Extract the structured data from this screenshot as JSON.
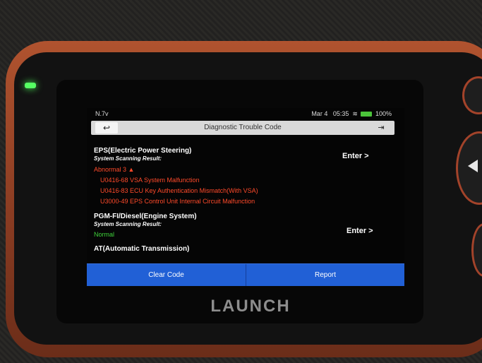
{
  "device": {
    "brand": "LAUNCH"
  },
  "status_bar": {
    "left": "N.7v",
    "date": "Mar 4",
    "time": "05:35",
    "battery": "100%"
  },
  "titlebar": {
    "back_icon": "↩",
    "title": "Diagnostic Trouble Code",
    "exit_icon": "exit-icon"
  },
  "systems": [
    {
      "name": "EPS(Electric Power Steering)",
      "scan_label": "System Scanning Result:",
      "status": "Abnormal 3",
      "enter": "Enter >",
      "codes": [
        "U0416-68 VSA System Malfunction",
        "U0416-83 ECU Key Authentication Mismatch(With VSA)",
        "U3000-49 EPS Control Unit Internal Circuit Malfunction"
      ]
    },
    {
      "name": "PGM-FI/Diesel(Engine System)",
      "scan_label": "System Scanning Result:",
      "status": "Normal",
      "enter": "Enter >"
    },
    {
      "name": "AT(Automatic Transmission)"
    }
  ],
  "bottom_bar": {
    "clear": "Clear Code",
    "report": "Report"
  },
  "colors": {
    "abnormal": "#ff4a2a",
    "normal": "#3fd23a",
    "action_bar": "#2160d6"
  }
}
